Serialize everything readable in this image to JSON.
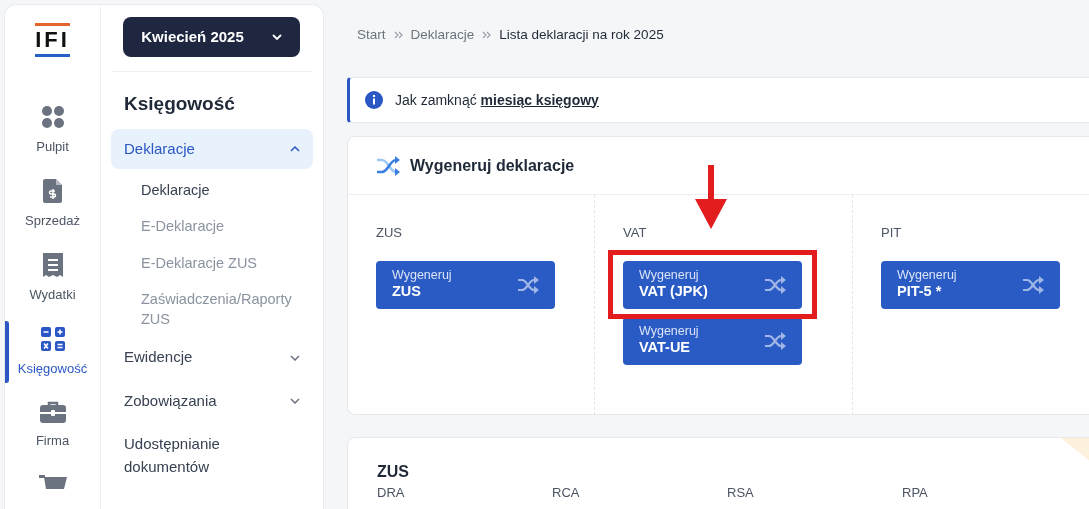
{
  "logo": {
    "text": "IFI"
  },
  "month_picker": {
    "label": "Kwiecień 2025"
  },
  "rail": [
    {
      "label": "Pulpit",
      "kind": "dots",
      "selected": false
    },
    {
      "label": "Sprzedaż",
      "kind": "invoice",
      "selected": false
    },
    {
      "label": "Wydatki",
      "kind": "receipt",
      "selected": false
    },
    {
      "label": "Księgowość",
      "kind": "calculator",
      "selected": true
    },
    {
      "label": "Firma",
      "kind": "briefcase",
      "selected": false
    },
    {
      "kind": "cart"
    }
  ],
  "section_title": "Księgowość",
  "menu": [
    {
      "label": "Deklaracje",
      "expanded": true,
      "selected": true,
      "children": [
        {
          "label": "Deklaracje",
          "selected": true
        },
        {
          "label": "E-Deklaracje",
          "selected": false
        },
        {
          "label": "E-Deklaracje ZUS",
          "selected": false
        },
        {
          "label": "Zaświadczenia/Raporty ZUS",
          "selected": false
        }
      ]
    },
    {
      "label": "Ewidencje",
      "expanded": false,
      "selected": false
    },
    {
      "label": "Zobowiązania",
      "expanded": false,
      "selected": false
    },
    {
      "label": "Udostępnianie dokumentów",
      "selected": false
    }
  ],
  "breadcrumbs": [
    "Start",
    "Deklaracje",
    "Lista deklaracji na rok 2025"
  ],
  "info": {
    "text": "Jak zamknąć",
    "link": "miesiąc księgowy"
  },
  "generate_card": {
    "title": "Wygeneruj deklaracje",
    "columns": [
      {
        "heading": "ZUS",
        "buttons": [
          {
            "caption": "Wygeneruj",
            "label": "ZUS",
            "highlighted": false
          }
        ]
      },
      {
        "heading": "VAT",
        "buttons": [
          {
            "caption": "Wygeneruj",
            "label": "VAT (JPK)",
            "highlighted": true
          },
          {
            "caption": "Wygeneruj",
            "label": "VAT-UE",
            "highlighted": false
          }
        ]
      },
      {
        "heading": "PIT",
        "buttons": [
          {
            "caption": "Wygeneruj",
            "label": "PIT-5 *",
            "highlighted": false
          }
        ]
      }
    ]
  },
  "zus_card": {
    "title": "ZUS",
    "columns": [
      "DRA",
      "RCA",
      "RSA",
      "RPA"
    ]
  }
}
